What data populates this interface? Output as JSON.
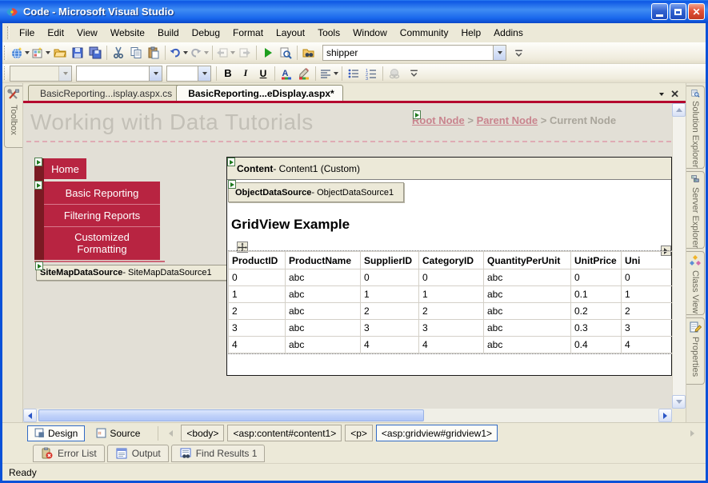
{
  "window": {
    "title": "Code - Microsoft Visual Studio"
  },
  "menu": {
    "items": [
      "File",
      "Edit",
      "View",
      "Website",
      "Build",
      "Debug",
      "Format",
      "Layout",
      "Tools",
      "Window",
      "Community",
      "Help",
      "Addins"
    ]
  },
  "toolbars": {
    "find_combo_value": "shipper",
    "bold_label": "B",
    "italic_label": "I",
    "underline_label": "U"
  },
  "doc_tabs": {
    "inactive": "BasicReporting...isplay.aspx.cs",
    "active": "BasicReporting...eDisplay.aspx*"
  },
  "side_panels": {
    "left_tab": "Toolbox",
    "right_tabs": [
      "Solution Explorer",
      "Server Explorer",
      "Class View",
      "Properties"
    ]
  },
  "design": {
    "page_title": "Working with Data Tutorials",
    "breadcrumb": {
      "root": "Root Node",
      "sep1": ">",
      "parent": "Parent Node",
      "sep2": ">",
      "current": "Current Node"
    },
    "nav": {
      "home": "Home",
      "items": [
        "Basic Reporting",
        "Filtering Reports",
        "Customized Formatting"
      ]
    },
    "sitemap": {
      "bold": "SiteMapDataSource",
      "rest": " - SiteMapDataSource1"
    },
    "content": {
      "header_bold": "Content",
      "header_rest": " - Content1 (Custom)",
      "ods_bold": "ObjectDataSource",
      "ods_rest": " - ObjectDataSource1",
      "heading": "GridView Example",
      "grid": {
        "columns": [
          "ProductID",
          "ProductName",
          "SupplierID",
          "CategoryID",
          "QuantityPerUnit",
          "UnitPrice",
          "Uni"
        ],
        "rows": [
          [
            "0",
            "abc",
            "0",
            "0",
            "abc",
            "0",
            "0"
          ],
          [
            "1",
            "abc",
            "1",
            "1",
            "abc",
            "0.1",
            "1"
          ],
          [
            "2",
            "abc",
            "2",
            "2",
            "abc",
            "0.2",
            "2"
          ],
          [
            "3",
            "abc",
            "3",
            "3",
            "abc",
            "0.3",
            "3"
          ],
          [
            "4",
            "abc",
            "4",
            "4",
            "abc",
            "0.4",
            "4"
          ]
        ]
      }
    }
  },
  "bottom_bar": {
    "design_btn": "Design",
    "source_btn": "Source",
    "tag_path": [
      "<body>",
      "<asp:content#content1>",
      "<p>",
      "<asp:gridview#gridview1>"
    ],
    "panel_tabs": [
      "Error List",
      "Output",
      "Find Results 1"
    ],
    "status": "Ready"
  },
  "colors": {
    "accent_crimson": "#B82441",
    "nav_strip_maroon": "#7B1A23",
    "tab_rule_red": "#B4092F",
    "breadcrumb_link_pink": "#C9848E",
    "watermark_gray": "#C3C0B7",
    "xp_title_blue": "#1866EC",
    "chrome_beige": "#ECE9D8"
  }
}
